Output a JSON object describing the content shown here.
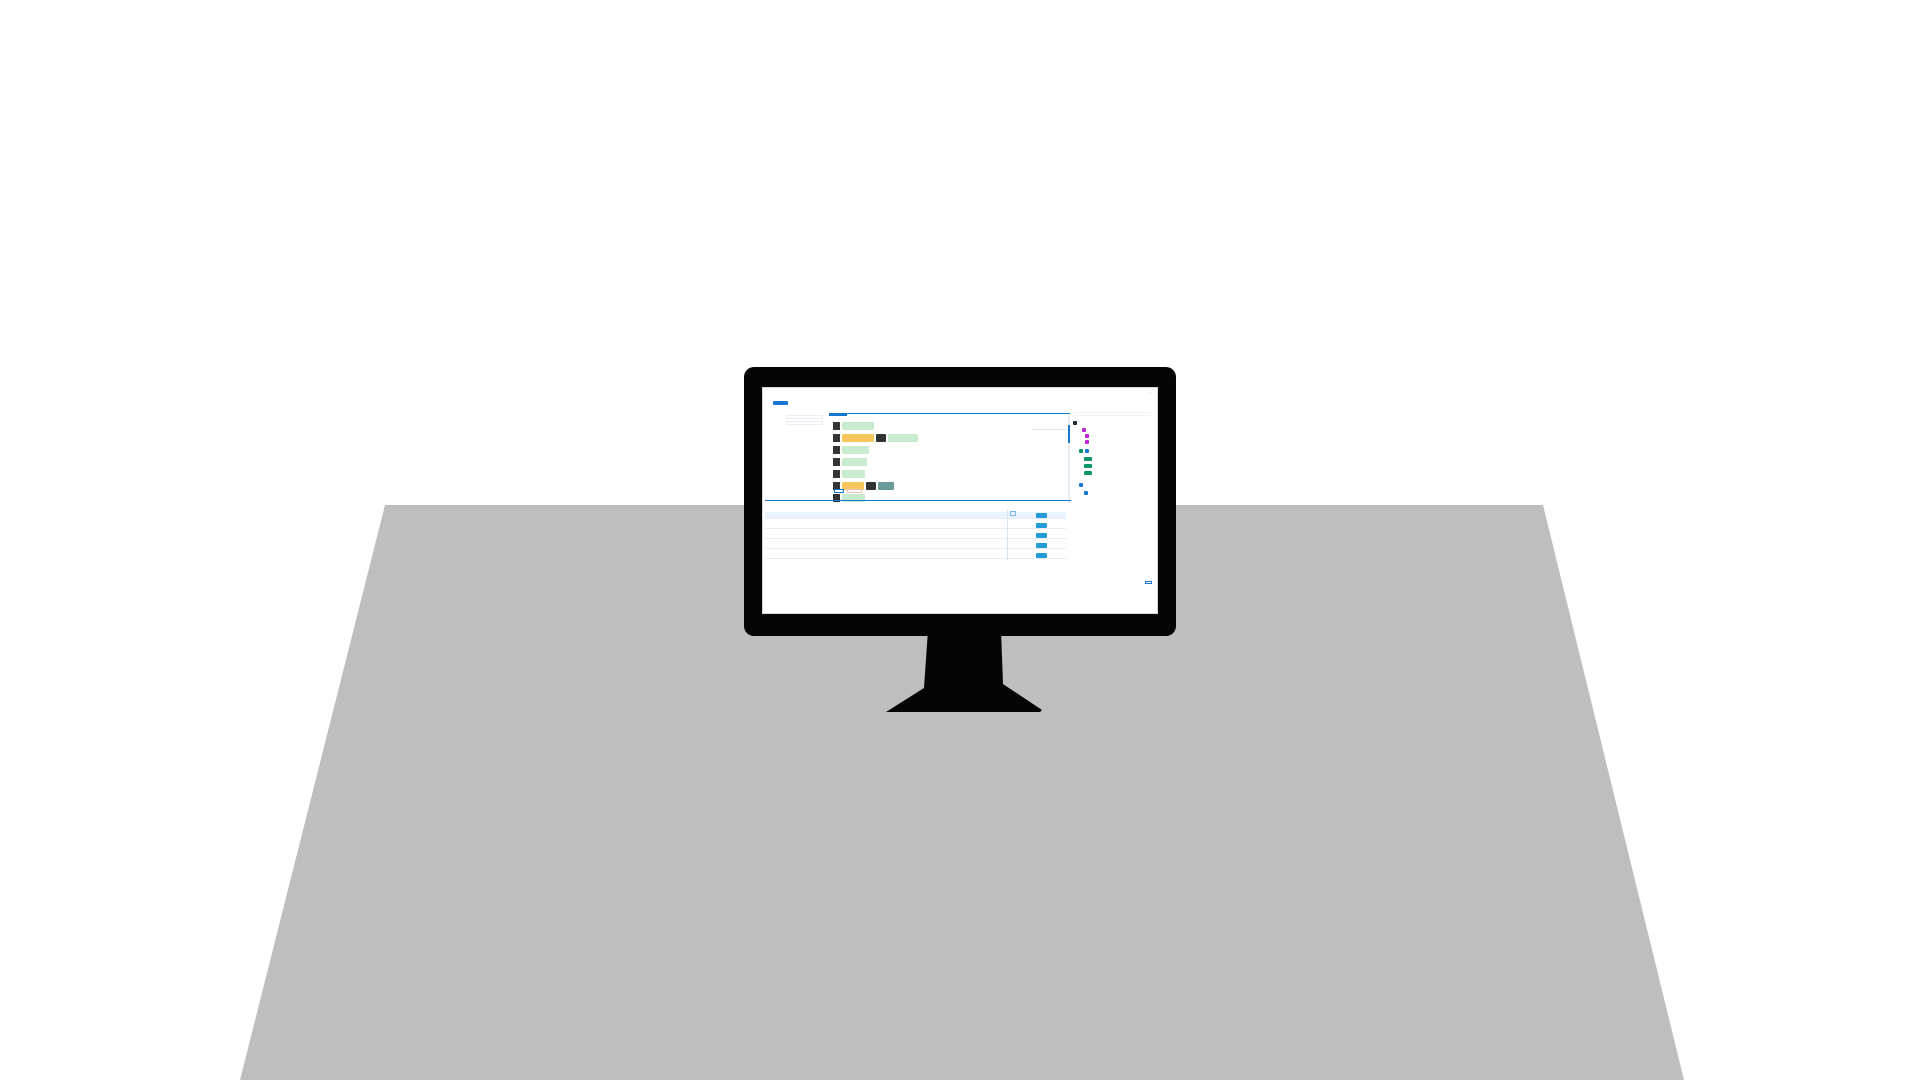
{
  "window": {
    "title": "",
    "controls": [
      "–",
      "×"
    ]
  },
  "top_nav": {
    "items": [
      "",
      "",
      "",
      "",
      ""
    ]
  },
  "filters": {
    "labels": [
      "",
      "",
      "",
      ""
    ],
    "small_text": [
      "",
      ""
    ]
  },
  "diagram": {
    "tabs": [
      "",
      ""
    ],
    "search_placeholder": "",
    "rows": [
      {
        "handle": "",
        "blocks": [
          {
            "label": "",
            "color": "#c9eccf"
          }
        ]
      },
      {
        "handle": "",
        "blocks": [
          {
            "label": "",
            "color": "#f5c85c"
          },
          {
            "label": "",
            "color": "#2f3433"
          },
          {
            "label": "",
            "color": "#c9eccf"
          }
        ]
      },
      {
        "handle": "",
        "blocks": [
          {
            "label": "",
            "color": "#c9eccf"
          }
        ]
      },
      {
        "handle": "",
        "blocks": [
          {
            "label": "",
            "color": "#c9eccf"
          }
        ]
      },
      {
        "handle": "",
        "blocks": [
          {
            "label": "",
            "color": "#c9eccf"
          }
        ]
      },
      {
        "handle": "",
        "blocks": [
          {
            "label": "",
            "color": "#f5c85c"
          },
          {
            "label": "",
            "color": "#2f3433"
          },
          {
            "label": "",
            "color": "#6a9a99"
          }
        ]
      },
      {
        "handle": "",
        "blocks": [
          {
            "label": "",
            "color": "#c9eccf"
          }
        ]
      }
    ],
    "footer_left": "",
    "footer_right": ""
  },
  "right_panel": {
    "search_placeholder": "",
    "tree": [
      {
        "label": "",
        "icon_color": "#1f2937"
      },
      {
        "label": "",
        "icon_color": "#c026d3"
      },
      {
        "label": "",
        "icon_color": "#c026d3"
      },
      {
        "label": "",
        "icon_color": "#c026d3"
      },
      {
        "label": "",
        "icon_color": "#059669"
      },
      {
        "label": "",
        "icon_color": "#059669"
      },
      {
        "label": "",
        "icon_color": "#059669"
      },
      {
        "label": "",
        "icon_color": "#059669"
      },
      {
        "label": "",
        "icon_color": "#1677d2"
      },
      {
        "label": "",
        "icon_color": "#1677d2"
      }
    ],
    "tabs": [
      "",
      "",
      "",
      ""
    ],
    "detail_lines": [
      "",
      ""
    ],
    "button": ""
  },
  "table": {
    "headers": [
      "",
      "",
      "",
      "",
      "",
      "",
      "",
      "",
      "",
      "",
      "",
      "",
      "",
      "",
      "",
      ""
    ],
    "rows": [
      {
        "cells": [
          "",
          "",
          "",
          "",
          "",
          "",
          "",
          "",
          "",
          "",
          "",
          "",
          "",
          "",
          "",
          ""
        ],
        "selected": true,
        "action": ""
      },
      {
        "cells": [
          "",
          "",
          "",
          "",
          "",
          "",
          "",
          "",
          "",
          "",
          "",
          "",
          "",
          "",
          "",
          ""
        ],
        "selected": false,
        "action": ""
      },
      {
        "cells": [
          "",
          "",
          "",
          "",
          "",
          "",
          "",
          "",
          "",
          "",
          "",
          "",
          "",
          "",
          "",
          ""
        ],
        "selected": false,
        "action": ""
      },
      {
        "cells": [
          "",
          "",
          "",
          "",
          "",
          "",
          "",
          "",
          "",
          "",
          "",
          "",
          "",
          "",
          "",
          ""
        ],
        "selected": false,
        "action": ""
      },
      {
        "cells": [
          "",
          "",
          "",
          "",
          "",
          "",
          "",
          "",
          "",
          "",
          "",
          "",
          "",
          "",
          "",
          ""
        ],
        "selected": false,
        "action": ""
      }
    ],
    "title": "",
    "subtitle": "",
    "pager": [
      "",
      "",
      "",
      "",
      ""
    ]
  },
  "colors": {
    "accent": "#1677d2",
    "table_action": "#239bd6",
    "desk": "#bebebe",
    "monitor": "#050505"
  }
}
